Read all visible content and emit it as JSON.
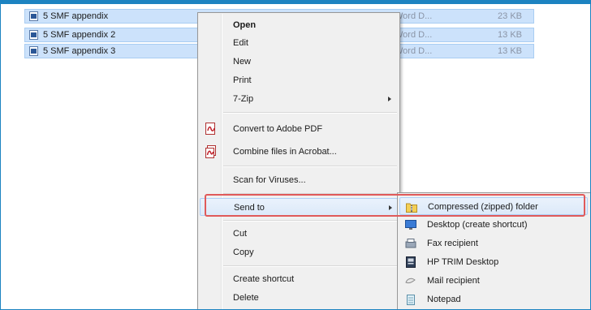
{
  "files": [
    {
      "name": "5 SMF appendix",
      "type": "Word D...",
      "size": "23 KB"
    },
    {
      "name": "5 SMF appendix 2",
      "type": "Word D...",
      "size": "13 KB"
    },
    {
      "name": "5 SMF appendix 3",
      "type": "Word D...",
      "size": "13 KB"
    }
  ],
  "context_menu": {
    "open": "Open",
    "edit": "Edit",
    "new": "New",
    "print": "Print",
    "seven_zip": "7-Zip",
    "convert_pdf": "Convert to Adobe PDF",
    "combine_acrobat": "Combine files in Acrobat...",
    "scan_viruses": "Scan for Viruses...",
    "send_to": "Send to",
    "cut": "Cut",
    "copy": "Copy",
    "create_shortcut": "Create shortcut",
    "delete": "Delete"
  },
  "send_to_menu": {
    "compressed": "Compressed (zipped) folder",
    "desktop": "Desktop (create shortcut)",
    "fax": "Fax recipient",
    "hp_trim": "HP TRIM Desktop",
    "mail": "Mail recipient",
    "notepad": "Notepad"
  },
  "colors": {
    "frame_accent": "#1c83c1",
    "selection": "#cce2fb",
    "highlight_annotation": "#e05a5a"
  },
  "icons": {
    "file": "word-document-icon",
    "submenu_arrow": "chevron-right-icon",
    "pdf": "adobe-pdf-icon",
    "acrobat": "acrobat-combine-icon",
    "zip": "zip-folder-icon",
    "desktop": "desktop-icon",
    "fax": "fax-icon",
    "hp_trim": "hp-trim-icon",
    "mail": "mail-icon",
    "notepad": "notepad-icon"
  }
}
